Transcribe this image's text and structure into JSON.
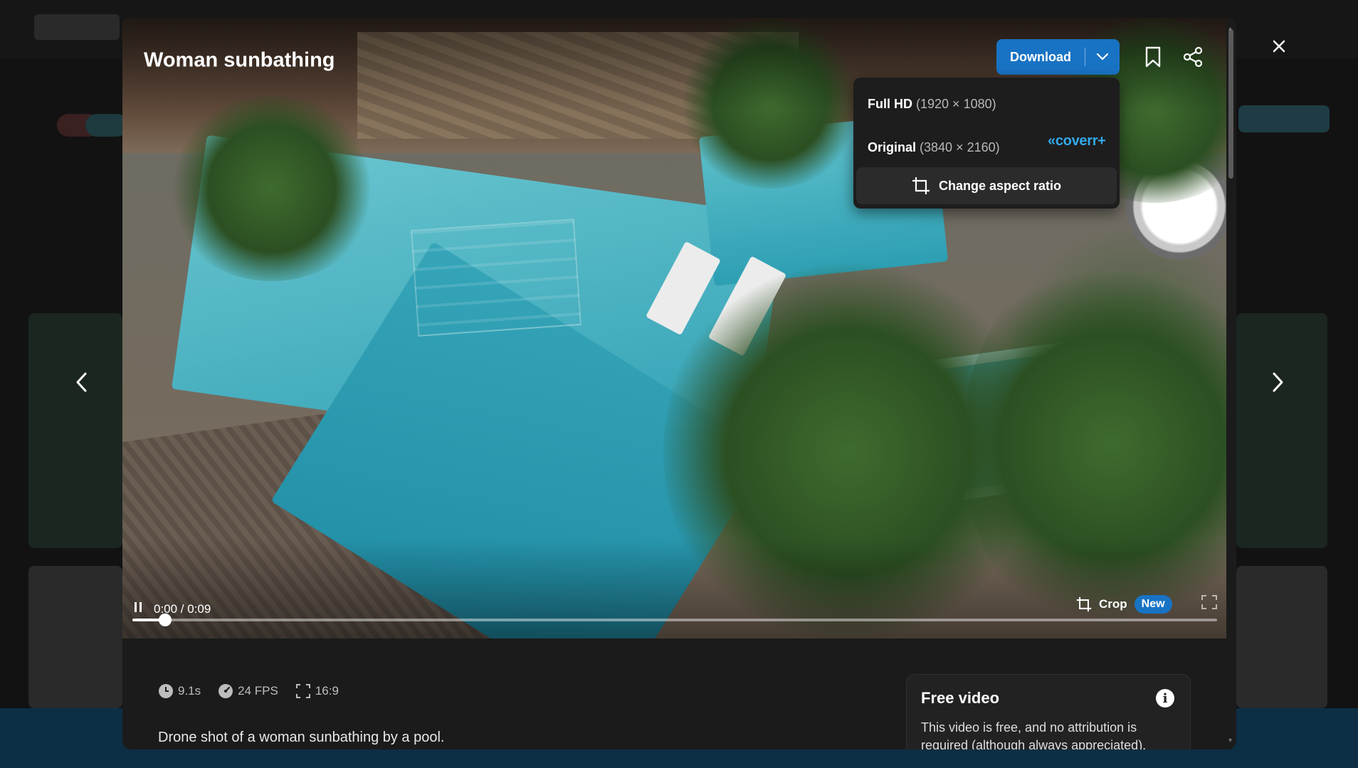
{
  "modal": {
    "title": "Woman sunbathing",
    "description": "Drone shot of a woman sunbathing by a pool."
  },
  "toolbar": {
    "download_label": "Download",
    "bookmark_icon": "bookmark-icon",
    "share_icon": "share-icon"
  },
  "download_menu": {
    "full_hd": {
      "label": "Full HD",
      "resolution": "(1920 × 1080)"
    },
    "original": {
      "label": "Original",
      "resolution": "(3840 × 2160)",
      "brand": "«coverr+"
    },
    "aspect_button": "Change aspect ratio"
  },
  "player": {
    "time": "0:00 / 0:09",
    "crop_label": "Crop",
    "new_badge": "New",
    "progress": 0.03
  },
  "meta": {
    "duration": "9.1s",
    "fps": "24 FPS",
    "aspect": "16:9"
  },
  "free_card": {
    "title": "Free video",
    "text": "This video is free, and no attribution is required (although always appreciated)."
  },
  "colors": {
    "accent": "#1973c4",
    "brand": "#33a9e8"
  }
}
